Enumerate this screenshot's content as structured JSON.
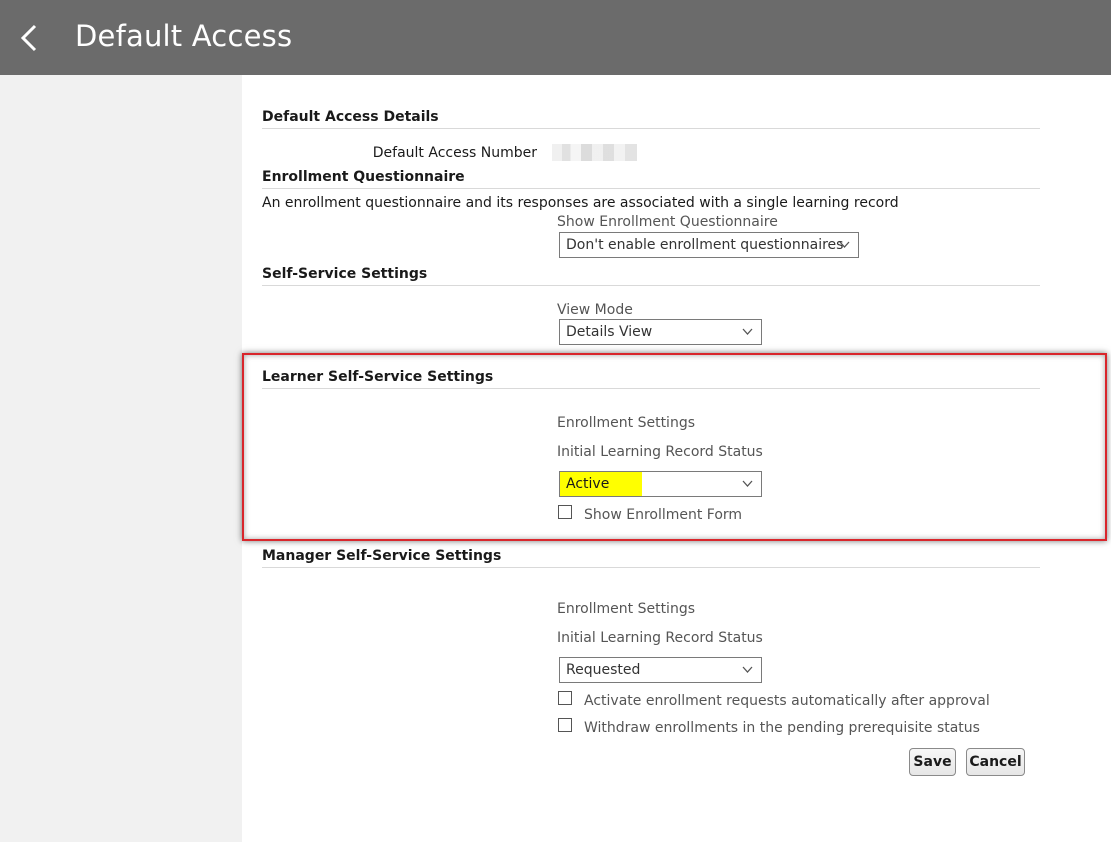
{
  "header": {
    "title": "Default Access",
    "back_icon": "chevron-left-icon"
  },
  "sections": {
    "details": {
      "title": "Default Access Details",
      "number_label": "Default Access Number"
    },
    "questionnaire": {
      "title": "Enrollment Questionnaire",
      "description": "An enrollment questionnaire and its responses are associated with a single learning record",
      "show_label": "Show Enrollment Questionnaire",
      "show_value": "Don't enable enrollment questionnaires"
    },
    "self_service": {
      "title": "Self-Service Settings",
      "view_mode_label": "View Mode",
      "view_mode_value": "Details View"
    },
    "learner": {
      "title": "Learner Self-Service Settings",
      "enrollment_settings": "Enrollment Settings",
      "status_label": "Initial Learning Record Status",
      "status_value": "Active",
      "show_form_label": "Show Enrollment Form",
      "show_form_checked": false
    },
    "manager": {
      "title": "Manager Self-Service Settings",
      "enrollment_settings": "Enrollment Settings",
      "status_label": "Initial Learning Record Status",
      "status_value": "Requested",
      "activate_label": "Activate enrollment requests automatically after approval",
      "withdraw_label": "Withdraw enrollments in the pending prerequisite status"
    }
  },
  "actions": {
    "save": "Save",
    "cancel": "Cancel"
  },
  "colors": {
    "header_bg": "#6b6b6b",
    "highlight": "#ffff00",
    "annotation_border": "#d9262c"
  }
}
